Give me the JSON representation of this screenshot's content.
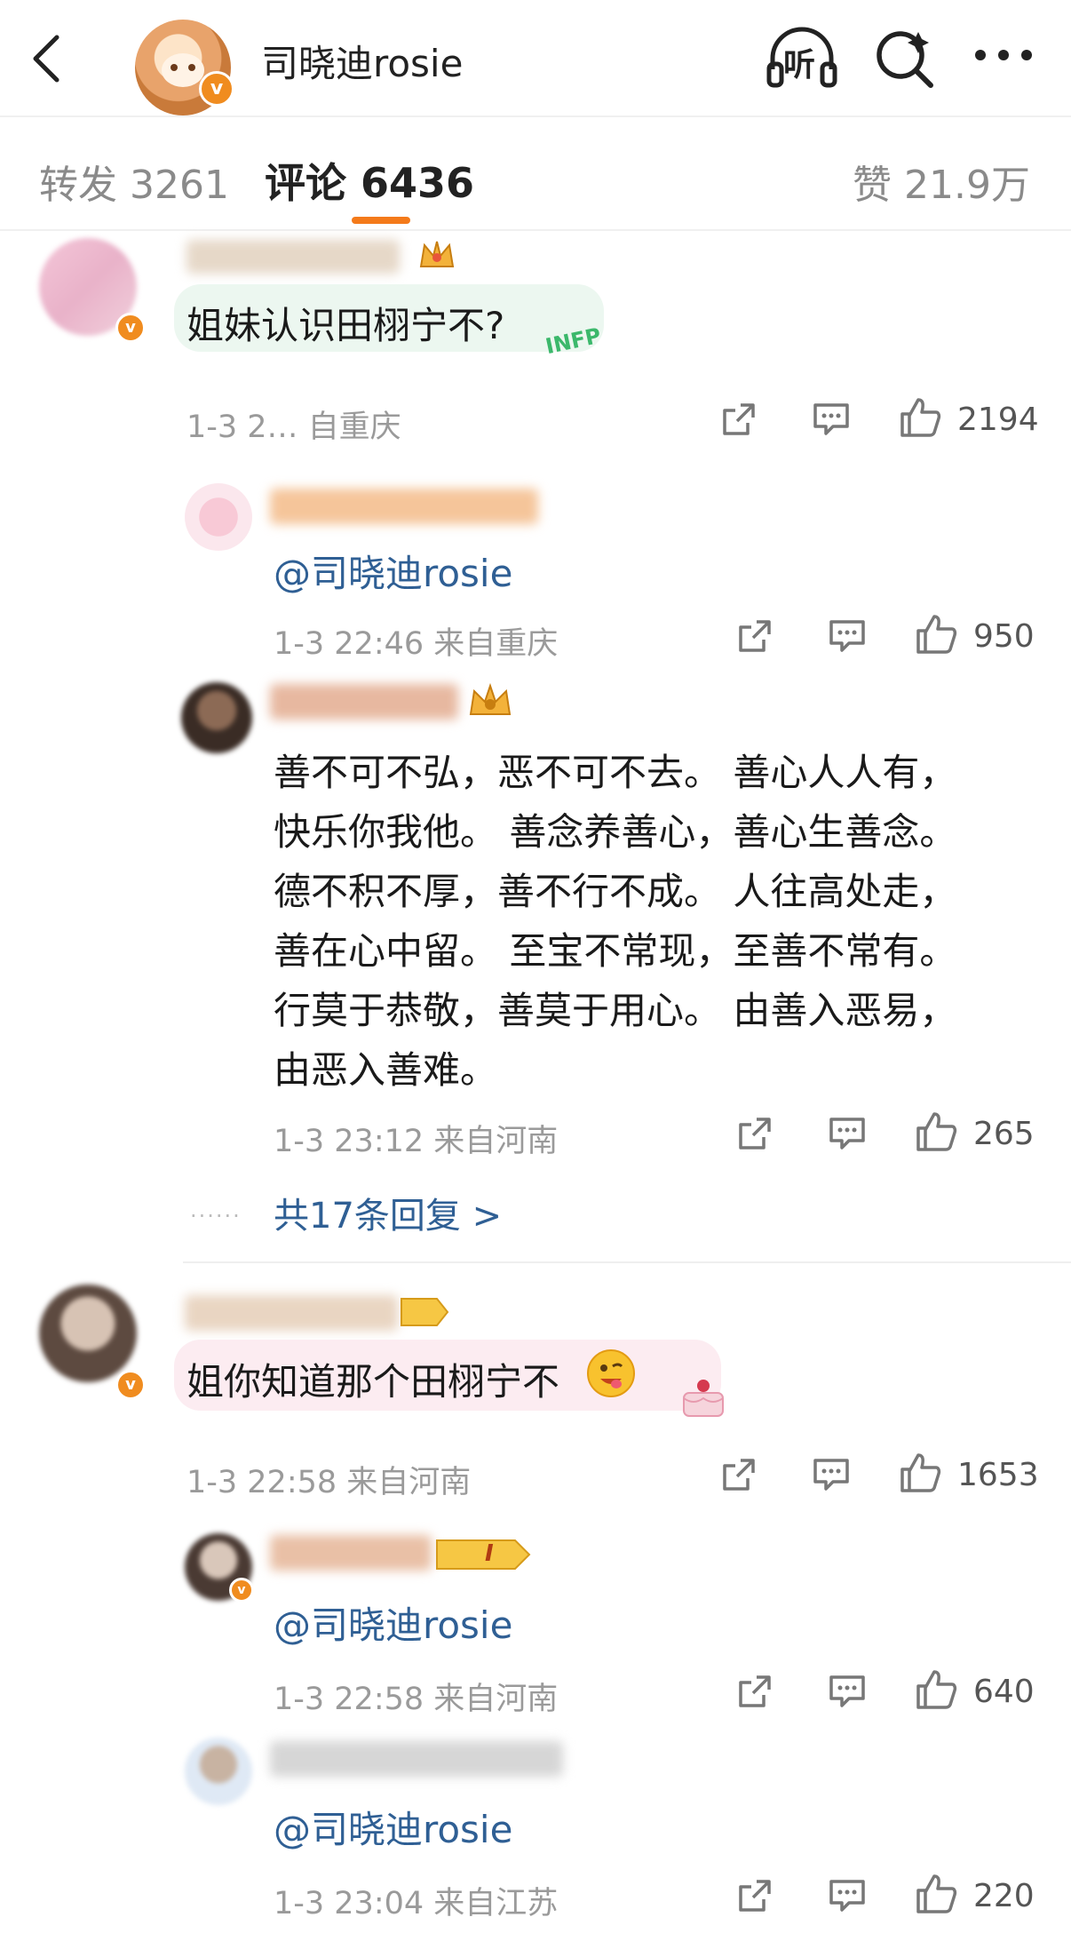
{
  "header": {
    "title": "司晓迪rosie",
    "listen_label": "听",
    "verified": "v"
  },
  "tabs": {
    "repost": "转发 3261",
    "comments": "评论 6436",
    "likes": "赞 21.9万"
  },
  "comments": [
    {
      "text": "姐妹认识田栩宁不?",
      "badge": "INFP",
      "meta": "1-3 2… 自重庆",
      "likes": "2194",
      "replies": [
        {
          "mention": "@司晓迪rosie",
          "meta": "1-3 22:46 来自重庆",
          "likes": "950"
        },
        {
          "lines": [
            "善不可不弘，恶不可不去。 善心人人有，",
            "快乐你我他。 善念养善心，善心生善念。",
            "德不积不厚，善不行不成。 人往高处走，",
            "善在心中留。 至宝不常现，至善不常有。",
            "行莫于恭敬，善莫于用心。 由善入恶易，",
            "由恶入善难。"
          ],
          "meta": "1-3 23:12 来自河南",
          "likes": "265"
        }
      ],
      "more_replies": "共17条回复 >"
    },
    {
      "text": "姐你知道那个田栩宁不",
      "meta": "1-3 22:58 来自河南",
      "likes": "1653",
      "replies": [
        {
          "mention": "@司晓迪rosie",
          "meta": "1-3 22:58 来自河南",
          "likes": "640",
          "badge": "I"
        },
        {
          "mention": "@司晓迪rosie",
          "meta": "1-3 23:04 来自江苏",
          "likes": "220"
        }
      ]
    }
  ],
  "colors": {
    "accent": "#f47a1a",
    "link": "#2f5f94",
    "meta": "#9a9a9a"
  }
}
